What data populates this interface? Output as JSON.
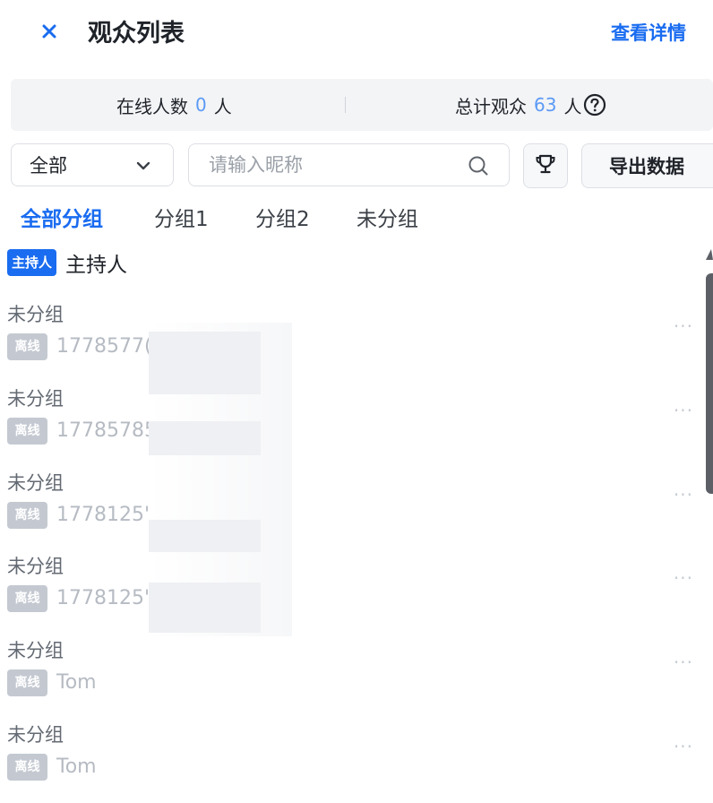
{
  "header": {
    "close_icon": "close-icon",
    "title": "观众列表",
    "detail_link": "查看详情",
    "accent_color": "#1a6cf0"
  },
  "stats": {
    "online_label": "在线人数",
    "online_count": "0",
    "online_unit": "人",
    "total_label": "总计观众",
    "total_count": "63",
    "total_unit": "人",
    "help_icon": "question-circle-icon"
  },
  "filters": {
    "group_select_value": "全部",
    "search_placeholder": "请输入昵称",
    "search_icon": "search-icon",
    "trophy_icon": "trophy-icon",
    "export_label": "导出数据"
  },
  "tabs": [
    {
      "label": "全部分组",
      "active": true
    },
    {
      "label": "分组1",
      "active": false
    },
    {
      "label": "分组2",
      "active": false
    },
    {
      "label": "未分组",
      "active": false
    }
  ],
  "host": {
    "badge": "主持人",
    "name": "主持人"
  },
  "viewers": [
    {
      "group": "未分组",
      "status": "离线",
      "name": "1778577("
    },
    {
      "group": "未分组",
      "status": "离线",
      "name": "17785785"
    },
    {
      "group": "未分组",
      "status": "离线",
      "name": "1778125'"
    },
    {
      "group": "未分组",
      "status": "离线",
      "name": "1778125'"
    },
    {
      "group": "未分组",
      "status": "离线",
      "name": "Tom"
    },
    {
      "group": "未分组",
      "status": "离线",
      "name": "Tom"
    }
  ],
  "more_label": "···"
}
